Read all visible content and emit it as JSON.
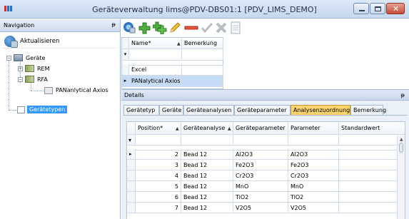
{
  "window": {
    "title": "Geräteverwaltung lims@PDV-DBS01:1 [PDV_LIMS_DEMO]",
    "minimize_glyph": "—",
    "restore_glyph": "❐",
    "close_glyph": "✕"
  },
  "navigation": {
    "header": "Navigation",
    "pin_glyph": "ᵽ",
    "refresh_label": "Aktualisieren",
    "tree": [
      {
        "label": "Geräte",
        "level": 0,
        "icon": "device-group-icon",
        "expanded": true
      },
      {
        "label": "REM",
        "level": 1,
        "icon": "device-type-icon",
        "expanded": false
      },
      {
        "label": "RFA",
        "level": 1,
        "icon": "device-type-icon",
        "expanded": true
      },
      {
        "label": "PANanlytical Axios",
        "level": 2,
        "icon": "device-icon"
      },
      {
        "label": "Gerätetypen",
        "level": 0,
        "icon": "folder-icon",
        "selected": true
      }
    ]
  },
  "toolbar": {
    "buttons": [
      {
        "name": "refresh-icon",
        "enabled": true
      },
      {
        "name": "add-icon",
        "enabled": true
      },
      {
        "name": "add-sub-icon",
        "enabled": true
      },
      {
        "name": "edit-pencil-icon",
        "enabled": true
      },
      {
        "name": "remove-minus-icon",
        "enabled": true
      },
      {
        "name": "confirm-check-icon",
        "enabled": false
      },
      {
        "name": "cancel-x-icon",
        "enabled": false
      },
      {
        "name": "document-icon",
        "enabled": false
      }
    ]
  },
  "device_grid": {
    "columns": [
      "Name*",
      "Bemerkung"
    ],
    "filter_glyph": "ᵧ",
    "rows": [
      {
        "name": "Excel",
        "remark": ""
      },
      {
        "name": "PANalytical Axios",
        "remark": "",
        "current": true
      }
    ]
  },
  "details": {
    "header": "Details",
    "pin_glyph": "ᵽ",
    "tabs": [
      "Gerätetyp",
      "Geräte",
      "Geräteanalysen",
      "Geräteparameter",
      "Analysenzuordnung",
      "Bemerkung"
    ],
    "active_tab": "Analysenzuordnung",
    "grid": {
      "columns": [
        "Position*",
        "Geräteanalyse",
        "Geräteparameter",
        "Parameter",
        "Standardwert"
      ],
      "rows": [
        {
          "position": "2",
          "analysis": "Bead 12",
          "device_param": "Al2O3",
          "param": "Al2O3",
          "default": "",
          "current": true
        },
        {
          "position": "3",
          "analysis": "Bead 12",
          "device_param": "Fe2O3",
          "param": "Fe2O3",
          "default": ""
        },
        {
          "position": "4",
          "analysis": "Bead 12",
          "device_param": "Cr2O3",
          "param": "Cr2O3",
          "default": ""
        },
        {
          "position": "5",
          "analysis": "Bead 12",
          "device_param": "MnO",
          "param": "MnO",
          "default": ""
        },
        {
          "position": "6",
          "analysis": "Bead 12",
          "device_param": "TiO2",
          "param": "TiO2",
          "default": ""
        },
        {
          "position": "7",
          "analysis": "Bead 12",
          "device_param": "V2O5",
          "param": "V2O5",
          "default": ""
        }
      ]
    }
  },
  "colors": {
    "selection": "#3399ff",
    "active_tab": "#ffd36b",
    "titlebar": "#c7d9ef"
  }
}
